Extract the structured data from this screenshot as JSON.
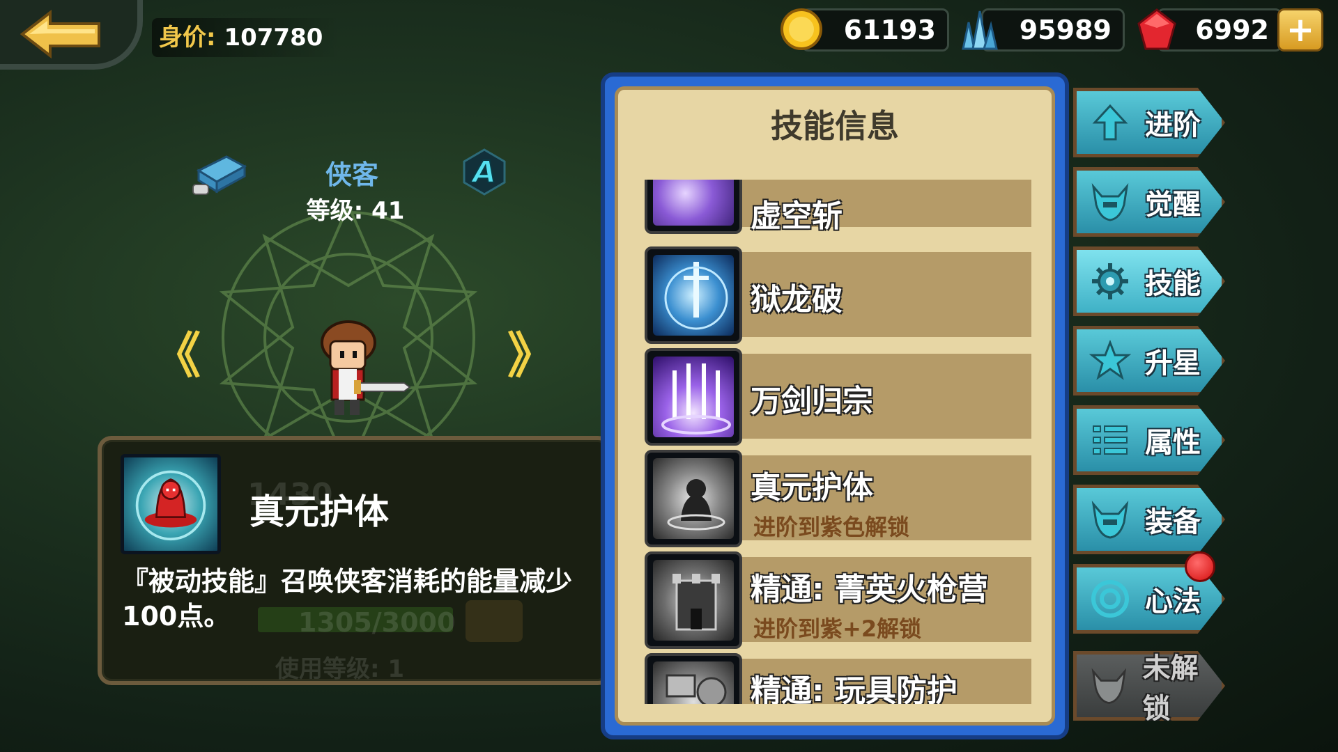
{
  "header": {
    "worth_label": "身价:",
    "worth_value": "107780"
  },
  "currencies": [
    {
      "icon": "gold-coin-icon",
      "value": "61193"
    },
    {
      "icon": "crystal-icon",
      "value": "95989"
    },
    {
      "icon": "ruby-gem-icon",
      "value": "6992"
    }
  ],
  "add_button_label": "+",
  "character": {
    "name": "侠客",
    "level_text": "等级: 41",
    "rank": "A",
    "prev_arrow": "《",
    "next_arrow": "》"
  },
  "skill_detail": {
    "title": "真元护体",
    "description": "『被动技能』召唤侠客消耗的能量减少100点。",
    "ghost_number": "1430",
    "ghost_progress": "1305/3000",
    "ghost_use_level": "使用等级: 1"
  },
  "skill_panel": {
    "title": "技能信息",
    "skills": [
      {
        "name": "虚空斩",
        "sub": ""
      },
      {
        "name": "狱龙破",
        "sub": ""
      },
      {
        "name": "万剑归宗",
        "sub": ""
      },
      {
        "name": "真元护体",
        "sub": "进阶到紫色解锁"
      },
      {
        "name": "精通: 菁英火枪营",
        "sub": "进阶到紫+2解锁"
      },
      {
        "name": "精通: 玩具防护",
        "sub": ""
      }
    ]
  },
  "side_menu": [
    {
      "label": "进阶",
      "icon": "arrow-up-icon"
    },
    {
      "label": "觉醒",
      "icon": "horned-helmet-icon"
    },
    {
      "label": "技能",
      "icon": "gear-icon",
      "active": true
    },
    {
      "label": "升星",
      "icon": "star-icon"
    },
    {
      "label": "属性",
      "icon": "list-icon"
    },
    {
      "label": "装备",
      "icon": "horned-helmet-icon"
    },
    {
      "label": "心法",
      "icon": "target-icon"
    },
    {
      "label": "未解锁",
      "icon": "locked-emblem-icon",
      "locked": true
    }
  ],
  "colors": {
    "panel_blue": "#2a6ad4",
    "parchment": "#e7d6a4",
    "menu_cyan": "#59c9d8",
    "gold_text": "#f2c84b",
    "name_blue": "#6fb7ea"
  }
}
